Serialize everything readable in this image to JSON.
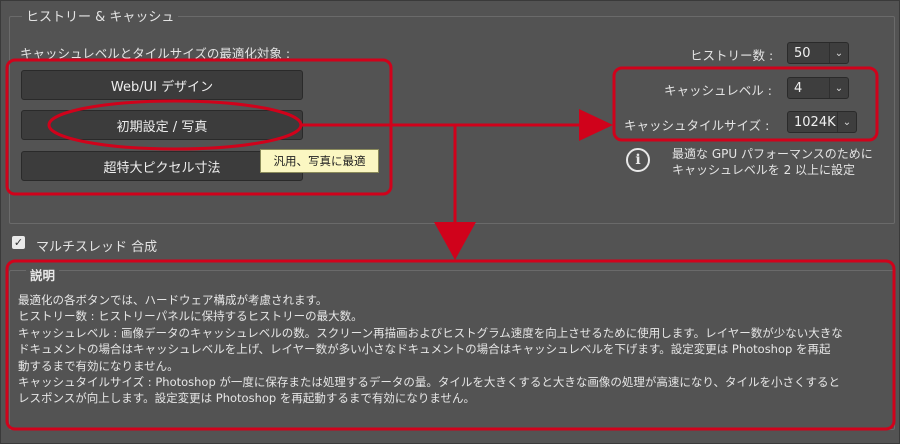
{
  "section_title": "ヒストリー & キャッシュ",
  "optimize_label": "キャッシュレベルとタイルサイズの最適化対象 :",
  "buttons": {
    "web_ui": "Web/UI デザイン",
    "default_photo": "初期設定 / 写真",
    "huge_pixel": "超特大ピクセル寸法"
  },
  "tooltip": "汎用、写真に最適",
  "history_states": {
    "label": "ヒストリー数 :",
    "value": "50"
  },
  "cache_levels": {
    "label": "キャッシュレベル :",
    "value": "4"
  },
  "cache_tile_size": {
    "label": "キャッシュタイルサイズ :",
    "value": "1024K"
  },
  "info": {
    "icon": "info-circle-icon",
    "line1": "最適な GPU パフォーマンスのために",
    "line2": "キャッシュレベルを 2 以上に設定"
  },
  "multithread": {
    "label": "マルチスレッド 合成",
    "checked": true
  },
  "description": {
    "title": "説明",
    "lines": [
      "最適化の各ボタンでは、ハードウェア構成が考慮されます。",
      "ヒストリー数 : ヒストリーパネルに保持するヒストリーの最大数。",
      "キャッシュレベル : 画像データのキャッシュレベルの数。スクリーン再描画およびヒストグラム速度を向上させるために使用します。レイヤー数が少ない大きな",
      "ドキュメントの場合はキャッシュレベルを上げ、レイヤー数が多い小さなドキュメントの場合はキャッシュレベルを下げます。設定変更は Photoshop を再起",
      "動するまで有効になりません。",
      "キャッシュタイルサイズ : Photoshop が一度に保存または処理するデータの量。タイルを大きくすると大きな画像の処理が高速になり、タイルを小さくすると",
      "レスポンスが向上します。設定変更は Photoshop を再起動するまで有効になりません。"
    ]
  },
  "annotation_color": "#d0021b"
}
